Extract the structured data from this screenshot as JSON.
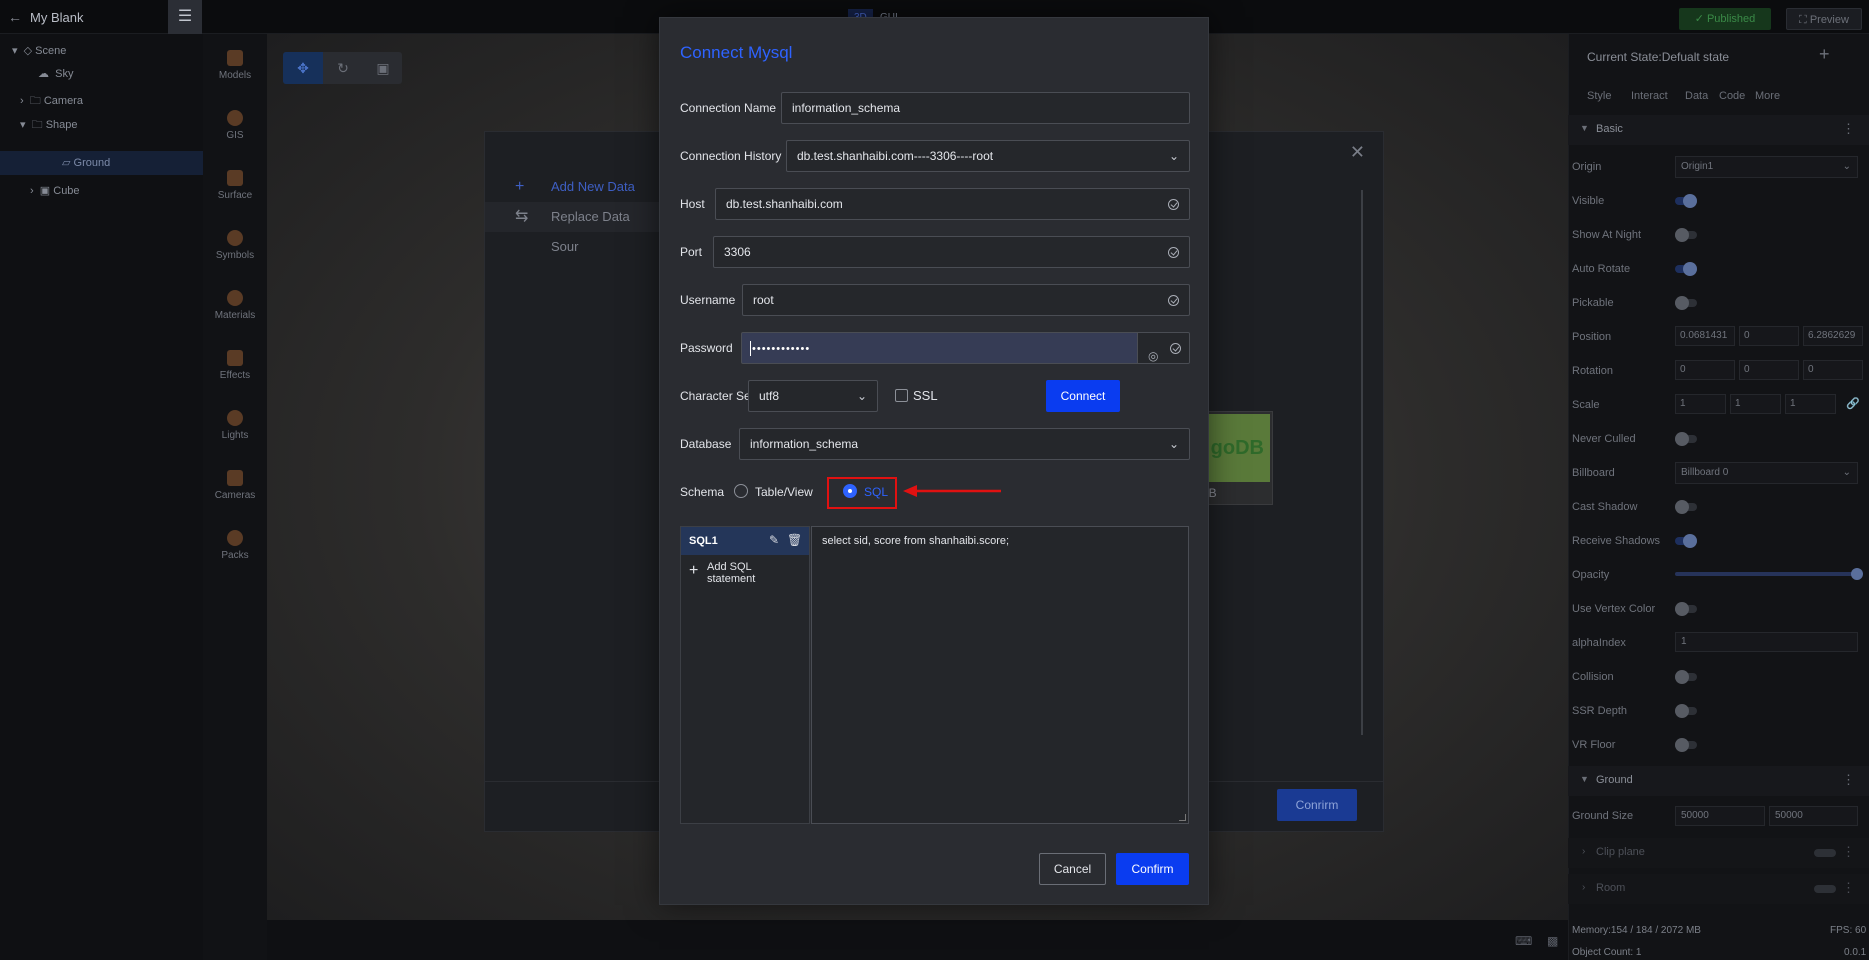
{
  "app": {
    "back_icon": "arrow-left-icon",
    "title": "My Blank",
    "menu_icon": "hamburger-icon",
    "modes": [
      "3D",
      "GUI"
    ],
    "published_label": "Published",
    "preview_label": "Preview"
  },
  "tree": {
    "items": [
      {
        "label": "Scene",
        "icon": "scene-icon"
      },
      {
        "label": "Sky",
        "icon": "sky-icon"
      },
      {
        "label": "Camera",
        "icon": "folder-icon"
      },
      {
        "label": "Shape",
        "icon": "folder-icon"
      },
      {
        "label": "Ground",
        "icon": "plane-icon"
      },
      {
        "label": "Cube",
        "icon": "cube-icon"
      }
    ]
  },
  "tools": [
    "Models",
    "GIS",
    "Surface",
    "Symbols",
    "Materials",
    "Effects",
    "Lights",
    "Cameras",
    "Packs"
  ],
  "data_source_modal": {
    "add_new": "Add New Data",
    "replace": "Replace Data Sour",
    "mongo_logo": "goDB",
    "mongo_caption": "DB",
    "confirm": "Conrirm"
  },
  "dialog": {
    "title": "Connect Mysql",
    "connection_name": {
      "label": "Connection Name",
      "value": "information_schema"
    },
    "connection_history": {
      "label": "Connection History",
      "value": "db.test.shanhaibi.com----3306----root"
    },
    "host": {
      "label": "Host",
      "value": "db.test.shanhaibi.com"
    },
    "port": {
      "label": "Port",
      "value": "3306"
    },
    "username": {
      "label": "Username",
      "value": "root"
    },
    "password": {
      "label": "Password",
      "masked": "••••••••••••"
    },
    "character_set": {
      "label": "Character Set",
      "value": "utf8"
    },
    "ssl_label": "SSL",
    "connect_label": "Connect",
    "database": {
      "label": "Database",
      "value": "information_schema"
    },
    "schema": {
      "label": "Schema",
      "option_table": "Table/View",
      "option_sql": "SQL",
      "selected": "SQL"
    },
    "sql_items": [
      {
        "name": "SQL1"
      }
    ],
    "add_sql_line1": "Add SQL",
    "add_sql_line2": "statement",
    "sql_text": "select sid, score from shanhaibi.score;",
    "cancel_label": "Cancel",
    "confirm_label": "Confirm"
  },
  "right_panel": {
    "state": "Current State:Defualt state",
    "tabs": [
      "Style",
      "Interact",
      "Data",
      "Code",
      "More"
    ],
    "section_basic": "Basic",
    "section_ground": "Ground",
    "props": {
      "origin": {
        "label": "Origin",
        "value": "Origin1"
      },
      "visible": "Visible",
      "show_at_night": "Show At Night",
      "auto_rotate": "Auto Rotate",
      "pickable": "Pickable",
      "position": {
        "label": "Position",
        "x": "0.0681431",
        "y": "0",
        "z": "6.2862629"
      },
      "rotation": {
        "label": "Rotation",
        "x": "0",
        "y": "0",
        "z": "0"
      },
      "scale": {
        "label": "Scale",
        "x": "1",
        "y": "1",
        "z": "1"
      },
      "never_culled": "Never Culled",
      "billboard": {
        "label": "Billboard",
        "value": "Billboard 0"
      },
      "cast_shadow": "Cast Shadow",
      "receive_shadows": "Receive Shadows",
      "opacity": "Opacity",
      "use_vertex_color": "Use Vertex Color",
      "alpha_index": {
        "label": "alphaIndex",
        "value": "1"
      },
      "collision": "Collision",
      "ssr_depth": "SSR Depth",
      "vr_floor": "VR Floor",
      "ground_size": {
        "label": "Ground Size",
        "w": "50000",
        "h": "50000"
      },
      "clip_plane": "Clip plane",
      "room": "Room"
    },
    "memory": "Memory:154 / 184 / 2072 MB",
    "fps": "FPS: 60",
    "object_count": "Object Count: 1",
    "version": "0.0.1"
  }
}
